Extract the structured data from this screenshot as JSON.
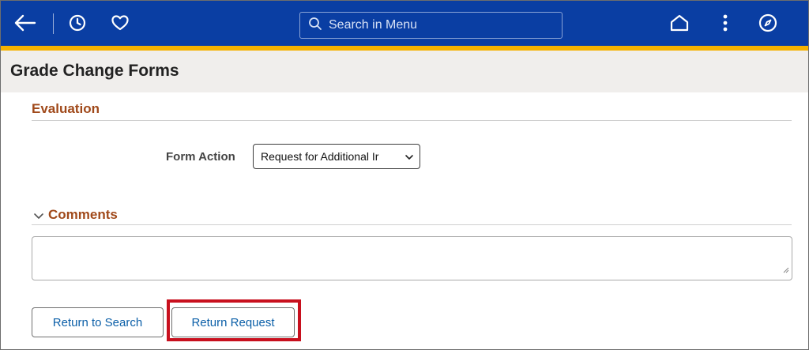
{
  "header": {
    "search_placeholder": "Search in Menu",
    "icons": [
      "back-arrow-icon",
      "history-icon",
      "favorites-heart-icon",
      "home-icon",
      "more-actions-icon",
      "navigator-compass-icon"
    ]
  },
  "page": {
    "title": "Grade Change Forms"
  },
  "evaluation": {
    "section_title": "Evaluation",
    "form_action_label": "Form Action",
    "form_action_value": "Request for Additional Ir"
  },
  "comments": {
    "section_title": "Comments",
    "value": ""
  },
  "buttons": {
    "return_to_search": "Return to Search",
    "return_request": "Return Request"
  },
  "colors": {
    "topbar": "#0a3ea3",
    "accent_line": "#f5b200",
    "section_title": "#a0491a",
    "button_text": "#0b5fa8",
    "highlight": "#c8101e"
  }
}
